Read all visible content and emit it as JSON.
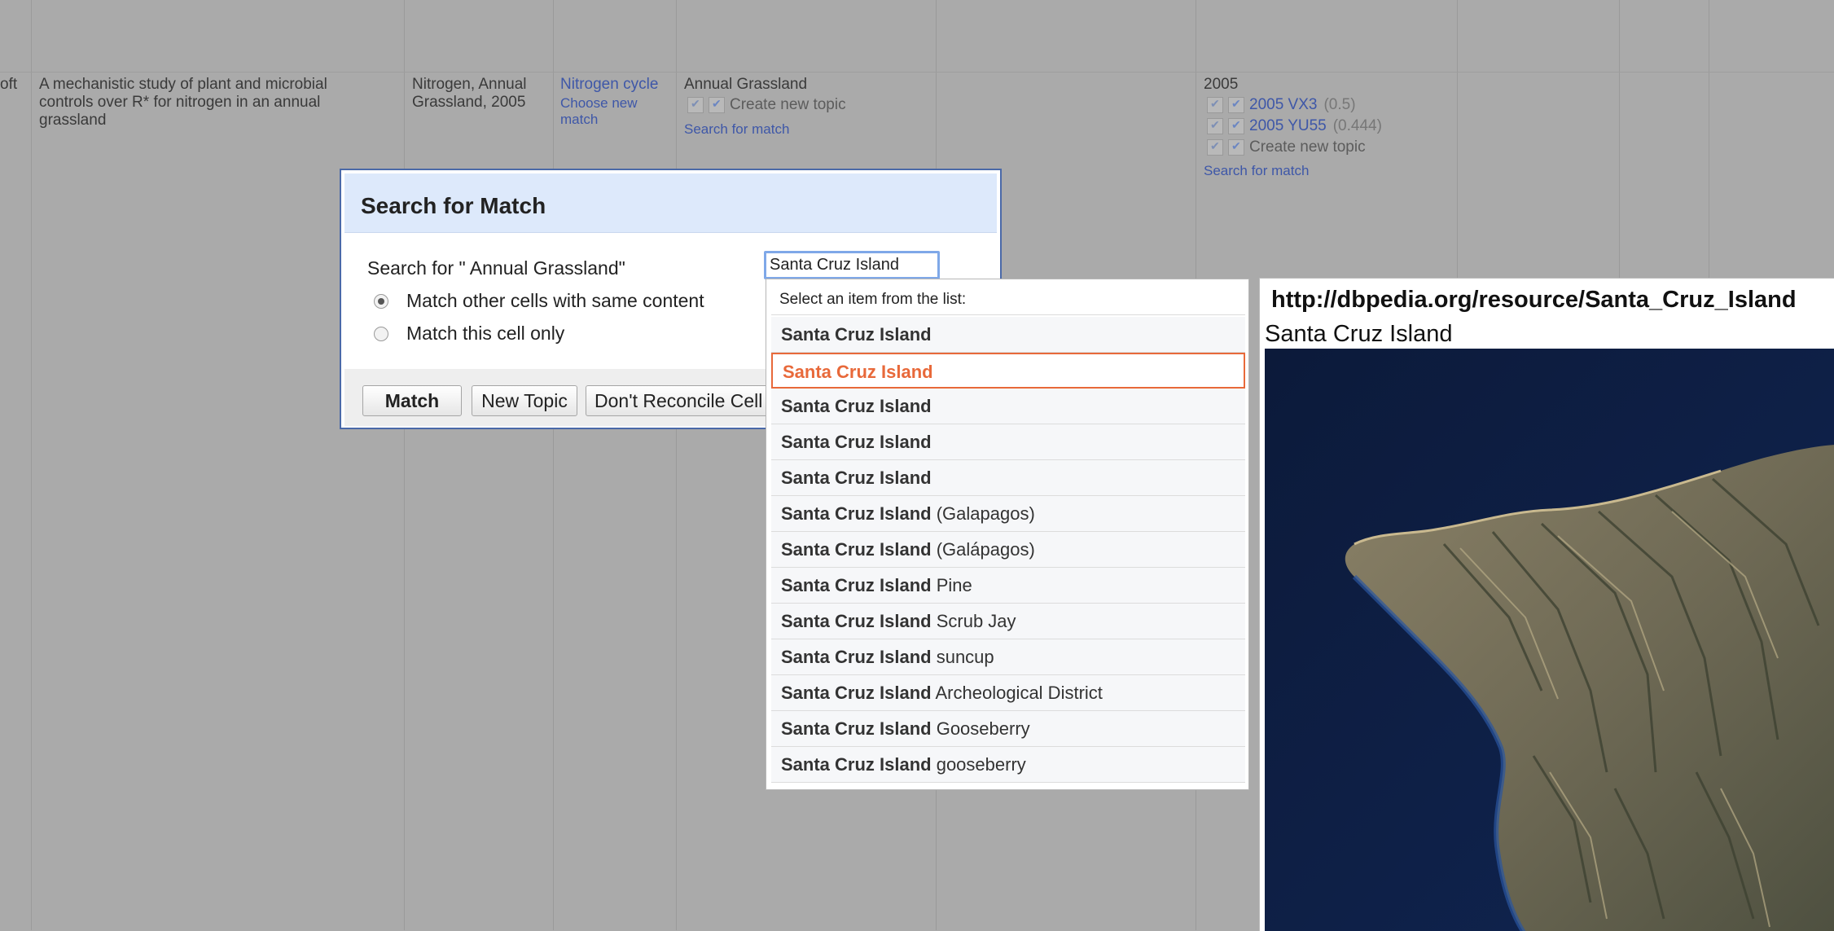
{
  "table": {
    "row_fragment": "oft",
    "description": "A mechanistic study of plant and microbial controls over R* for nitrogen in an annual grassland",
    "keywords": "Nitrogen, Annual Grassland, 2005",
    "col_nitrogen": {
      "matched_link": "Nitrogen cycle",
      "choose_new_match": "Choose new match"
    },
    "col_annual": {
      "value": "Annual Grassland",
      "create_new_topic": "Create new topic",
      "search_for_match": "Search for match"
    },
    "col_year": {
      "value": "2005",
      "candidates": [
        {
          "name": "2005 VX3",
          "score": "(0.5)"
        },
        {
          "name": "2005 YU55",
          "score": "(0.444)"
        }
      ],
      "create_new_topic": "Create new topic",
      "search_for_match": "Search for match"
    }
  },
  "dialog": {
    "title": "Search for Match",
    "search_for": "Search for \" Annual Grassland\"",
    "input_value": "Santa Cruz Island",
    "radio_same_content": "Match other cells with same content",
    "radio_this_cell": "Match this cell only",
    "buttons": {
      "match": "Match",
      "new_topic": "New Topic",
      "dont_reconcile": "Don't Reconcile Cell"
    }
  },
  "suggest": {
    "header": "Select an item from the list:",
    "items": [
      {
        "bold": "Santa Cruz Island",
        "rest": ""
      },
      {
        "bold": "Santa Cruz Island",
        "rest": ""
      },
      {
        "bold": "Santa Cruz Island",
        "rest": ""
      },
      {
        "bold": "Santa Cruz Island",
        "rest": ""
      },
      {
        "bold": "Santa Cruz Island",
        "rest": ""
      },
      {
        "bold": "Santa Cruz Island",
        "rest": " (Galapagos)"
      },
      {
        "bold": "Santa Cruz Island",
        "rest": " (Galápagos)"
      },
      {
        "bold": "Santa Cruz Island",
        "rest": " Pine"
      },
      {
        "bold": "Santa Cruz Island",
        "rest": " Scrub Jay"
      },
      {
        "bold": "Santa Cruz Island",
        "rest": " suncup"
      },
      {
        "bold": "Santa Cruz Island",
        "rest": " Archeological District"
      },
      {
        "bold": "Santa Cruz Island",
        "rest": " Gooseberry"
      },
      {
        "bold": "Santa Cruz Island",
        "rest": " gooseberry"
      }
    ],
    "selected_index": 1
  },
  "flyout": {
    "url": "http://dbpedia.org/resource/Santa_Cruz_Island",
    "name": "Santa Cruz Island"
  },
  "colors": {
    "background": "#aaaaaa",
    "dialog_header": "#dde9fb",
    "selected_accent": "#e8693a",
    "link": "#3e57a8"
  }
}
